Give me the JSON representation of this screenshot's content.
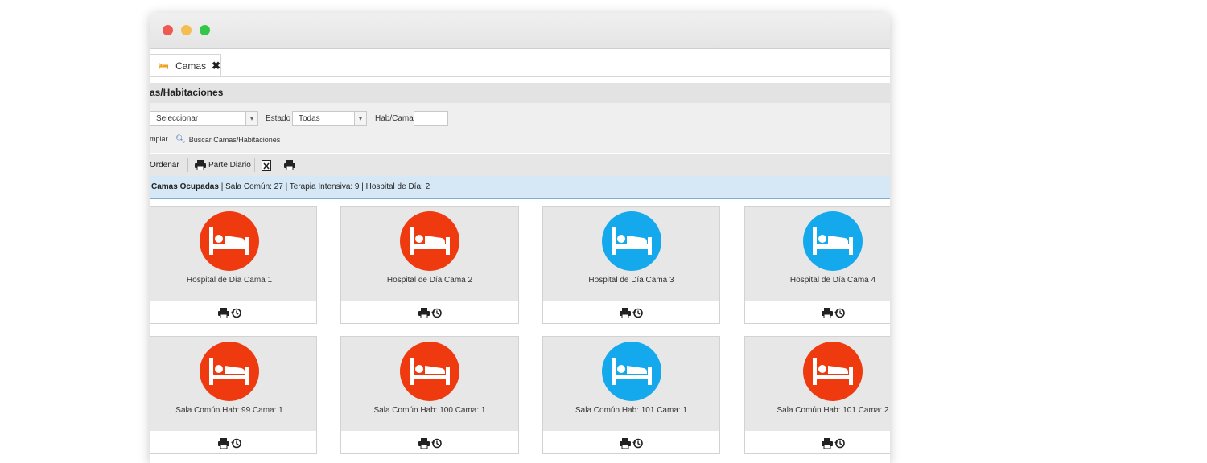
{
  "tab": {
    "label": "Camas"
  },
  "section": {
    "title": "as/Habitaciones"
  },
  "filters": {
    "first_select": "Seleccionar",
    "estado_label": "Estado",
    "estado_value": "Todas",
    "habcama_label": "Hab/Cama",
    "limpiar_label": "mpiar",
    "buscar_label": "Buscar Camas/Habitaciones"
  },
  "toolbar": {
    "ordenar_label": "Ordenar",
    "parte_diario_label": "Parte Diario"
  },
  "info": {
    "occupied_label": "Camas Ocupadas",
    "summary": "| Sala Común: 27 | Terapia Intensiva: 9 | Hospital de Día: 2"
  },
  "colors": {
    "occupied": "#ef3a0f",
    "free": "#14a9ec"
  },
  "cards": [
    {
      "label": "Hospital de Día Cama 1",
      "status": "occupied"
    },
    {
      "label": "Hospital de Día Cama 2",
      "status": "occupied"
    },
    {
      "label": "Hospital de Día Cama 3",
      "status": "free"
    },
    {
      "label": "Hospital de Día Cama 4",
      "status": "free"
    },
    {
      "label": "Sala Común Hab: 99 Cama: 1",
      "status": "occupied"
    },
    {
      "label": "Sala Común Hab: 100 Cama: 1",
      "status": "occupied"
    },
    {
      "label": "Sala Común Hab: 101 Cama: 1",
      "status": "free"
    },
    {
      "label": "Sala Común Hab: 101 Cama: 2",
      "status": "occupied"
    }
  ]
}
